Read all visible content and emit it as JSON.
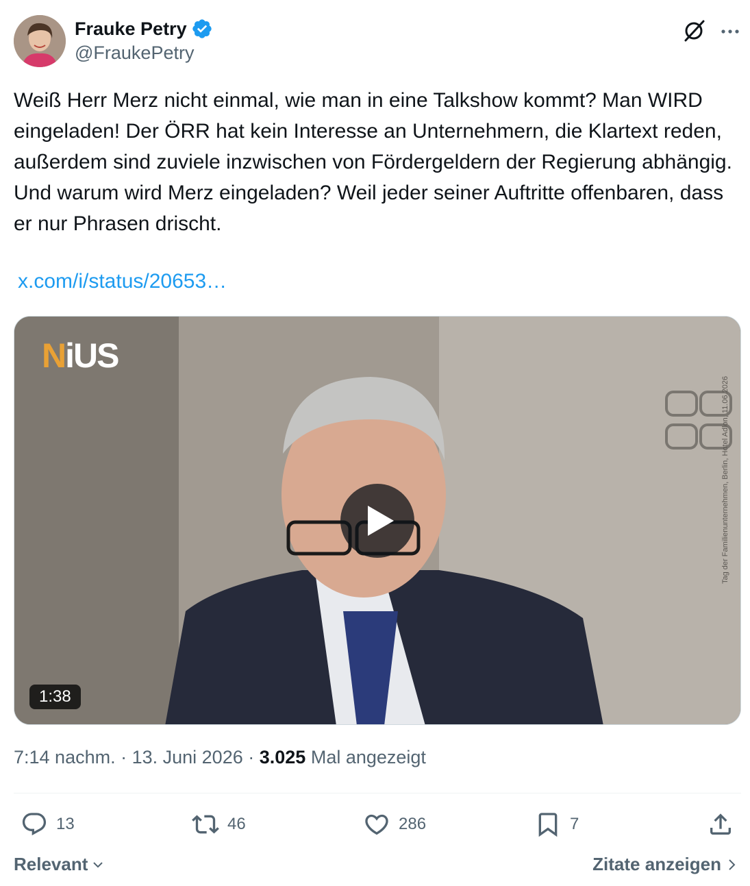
{
  "author": {
    "display_name": "Frauke Petry",
    "handle": "@FraukePetry",
    "verified_color": "#1d9bf0"
  },
  "icons": {
    "verified": "verified-badge-icon",
    "grok": "grok-icon",
    "more": "more-icon"
  },
  "tweet": {
    "text": "Weiß Herr Merz nicht einmal, wie man in eine Talkshow kommt? Man WIRD eingeladen! Der ÖRR hat kein Interesse an Unternehmern, die Klartext reden, außerdem sind zuviele inzwischen von Fördergeldern der Regierung abhängig.\nUnd warum wird Merz eingeladen? Weil jeder seiner Auftritte offenbaren, dass er nur Phrasen drischt.",
    "link": "x.com/i/status/20653…"
  },
  "media": {
    "logo_n": "N",
    "logo_rest": "iUS",
    "watermark": "Tag der Familienunternehmen, Berlin, Hotel Adlon, 11.06.2026",
    "duration": "1:38"
  },
  "meta": {
    "time": "7:14 nachm.",
    "separator": " · ",
    "date": "13. Juni 2026",
    "views": "3.025",
    "views_label": "Mal angezeigt"
  },
  "actions": {
    "replies": "13",
    "reposts": "46",
    "likes": "286",
    "bookmarks": "7"
  },
  "footer": {
    "sort_label": "Relevant",
    "quotes_label": "Zitate anzeigen"
  },
  "colors": {
    "link": "#1d9bf0",
    "secondary_text": "#536471",
    "primary_text": "#0f1419"
  }
}
